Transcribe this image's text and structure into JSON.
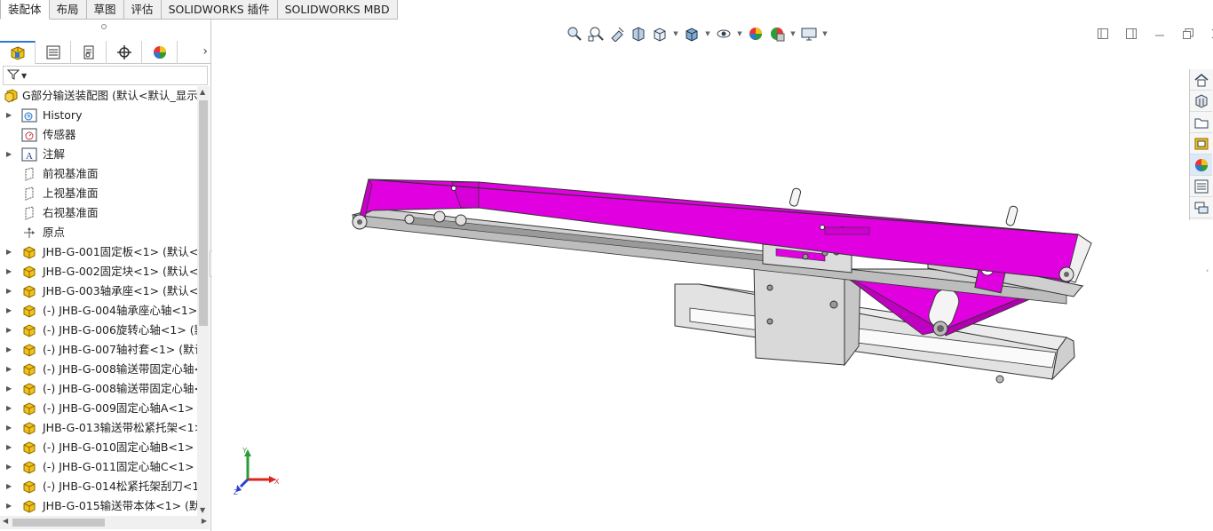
{
  "command_tabs": [
    {
      "label": "装配体",
      "active": true
    },
    {
      "label": "布局",
      "active": false
    },
    {
      "label": "草图",
      "active": false
    },
    {
      "label": "评估",
      "active": false
    },
    {
      "label": "SOLIDWORKS 插件",
      "active": false
    },
    {
      "label": "SOLIDWORKS MBD",
      "active": false
    }
  ],
  "panel_tabs": [
    "featuremanager-icon",
    "propertymanager-icon",
    "configurationmanager-icon",
    "dimxpert-icon",
    "displaymanager-icon"
  ],
  "tree": {
    "root": "G部分输送装配图 (默认<默认_显示状",
    "items": [
      {
        "label": "History",
        "icon": "history-icon",
        "expandable": true
      },
      {
        "label": "传感器",
        "icon": "sensor-icon",
        "expandable": false
      },
      {
        "label": "注解",
        "icon": "annotation-icon",
        "expandable": true
      },
      {
        "label": "前视基准面",
        "icon": "plane-icon",
        "expandable": false
      },
      {
        "label": "上视基准面",
        "icon": "plane-icon",
        "expandable": false
      },
      {
        "label": "右视基准面",
        "icon": "plane-icon",
        "expandable": false
      },
      {
        "label": "原点",
        "icon": "origin-icon",
        "expandable": false
      },
      {
        "label": "JHB-G-001固定板<1> (默认<<",
        "icon": "part-icon",
        "expandable": true
      },
      {
        "label": "JHB-G-002固定块<1> (默认<<",
        "icon": "part-icon",
        "expandable": true
      },
      {
        "label": "JHB-G-003轴承座<1> (默认<<",
        "icon": "part-icon",
        "expandable": true
      },
      {
        "label": "(-) JHB-G-004轴承座心轴<1> (",
        "icon": "part-icon",
        "expandable": true
      },
      {
        "label": "(-) JHB-G-006旋转心轴<1> (默",
        "icon": "part-icon",
        "expandable": true
      },
      {
        "label": "(-) JHB-G-007轴衬套<1> (默认",
        "icon": "part-icon",
        "expandable": true
      },
      {
        "label": "(-) JHB-G-008输送带固定心轴<",
        "icon": "part-icon",
        "expandable": true
      },
      {
        "label": "(-) JHB-G-008输送带固定心轴<",
        "icon": "part-icon",
        "expandable": true
      },
      {
        "label": "(-) JHB-G-009固定心轴A<1> (默",
        "icon": "part-icon",
        "expandable": true
      },
      {
        "label": "JHB-G-013输送带松紧托架<1>",
        "icon": "part-icon",
        "expandable": true
      },
      {
        "label": "(-) JHB-G-010固定心轴B<1> (默",
        "icon": "part-icon",
        "expandable": true
      },
      {
        "label": "(-) JHB-G-011固定心轴C<1> (默",
        "icon": "part-icon",
        "expandable": true
      },
      {
        "label": "(-) JHB-G-014松紧托架刮刀<1>",
        "icon": "part-icon",
        "expandable": true
      },
      {
        "label": "JHB-G-015输送带本体<1> (默认",
        "icon": "part-icon",
        "expandable": true
      }
    ]
  },
  "view_toolbar": [
    "zoom-to-fit-icon",
    "zoom-to-area-icon",
    "previous-view-icon",
    "section-view-icon",
    "view-orientation-icon",
    "display-style-icon",
    "hide-show-items-icon",
    "edit-appearance-icon",
    "apply-scene-icon",
    "view-settings-icon"
  ],
  "task_pane": [
    "home-icon",
    "resources-icon",
    "design-library-icon",
    "file-explorer-icon",
    "view-palette-icon",
    "appearances-icon",
    "custom-properties-icon",
    "forum-icon"
  ],
  "triad": {
    "x": "X",
    "y": "Y",
    "z": "Z"
  },
  "colors": {
    "belt": "#e000e0",
    "frame": "#d4d4d4",
    "accent": "#2b79d0"
  }
}
